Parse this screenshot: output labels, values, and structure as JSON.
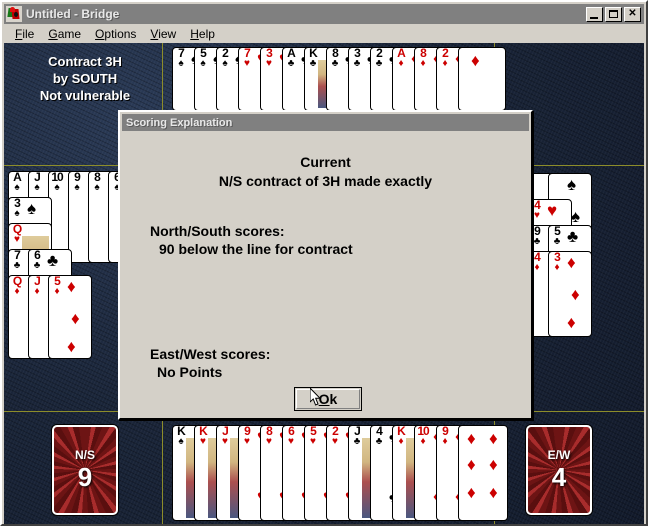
{
  "window": {
    "title": "Untitled - Bridge",
    "icon": "bridge-cards-icon",
    "buttons": {
      "minimize": "minimize-icon",
      "maximize": "maximize-icon",
      "close": "✕"
    }
  },
  "menu": {
    "items": [
      {
        "label": "File",
        "accel": "F"
      },
      {
        "label": "Game",
        "accel": "G"
      },
      {
        "label": "Options",
        "accel": "O"
      },
      {
        "label": "View",
        "accel": "V"
      },
      {
        "label": "Help",
        "accel": "H"
      }
    ]
  },
  "table": {
    "contract": {
      "line1": "Contract 3H",
      "line2": "by SOUTH",
      "line3": "Not vulnerable"
    },
    "scores": {
      "ns": {
        "label": "N/S",
        "value": "9"
      },
      "ew": {
        "label": "E/W",
        "value": "4"
      }
    },
    "hands": {
      "north": [
        {
          "rank": "7",
          "suit": "S"
        },
        {
          "rank": "5",
          "suit": "S"
        },
        {
          "rank": "2",
          "suit": "S"
        },
        {
          "rank": "7",
          "suit": "H"
        },
        {
          "rank": "3",
          "suit": "H"
        },
        {
          "rank": "A",
          "suit": "C"
        },
        {
          "rank": "K",
          "suit": "C"
        },
        {
          "rank": "8",
          "suit": "C"
        },
        {
          "rank": "3",
          "suit": "C"
        },
        {
          "rank": "2",
          "suit": "C"
        },
        {
          "rank": "A",
          "suit": "D"
        },
        {
          "rank": "8",
          "suit": "D"
        },
        {
          "rank": "2",
          "suit": "D"
        }
      ],
      "west": [
        {
          "rank": "A",
          "suit": "S"
        },
        {
          "rank": "J",
          "suit": "S"
        },
        {
          "rank": "10",
          "suit": "S"
        },
        {
          "rank": "9",
          "suit": "S"
        },
        {
          "rank": "8",
          "suit": "S"
        },
        {
          "rank": "6",
          "suit": "S"
        },
        {
          "rank": "3",
          "suit": "S"
        },
        {
          "rank": "Q",
          "suit": "H"
        },
        {
          "rank": "7",
          "suit": "C"
        },
        {
          "rank": "6",
          "suit": "C"
        },
        {
          "rank": "Q",
          "suit": "D"
        },
        {
          "rank": "J",
          "suit": "D"
        },
        {
          "rank": "5",
          "suit": "D"
        }
      ],
      "east": [
        {
          "rank": "",
          "suit": "S"
        },
        {
          "rank": "",
          "suit": "S"
        },
        {
          "rank": "4",
          "suit": "H"
        },
        {
          "rank": "9",
          "suit": "C"
        },
        {
          "rank": "5",
          "suit": "C"
        },
        {
          "rank": "4",
          "suit": "D"
        },
        {
          "rank": "3",
          "suit": "D"
        }
      ],
      "south": [
        {
          "rank": "K",
          "suit": "S"
        },
        {
          "rank": "K",
          "suit": "H"
        },
        {
          "rank": "J",
          "suit": "H"
        },
        {
          "rank": "9",
          "suit": "H"
        },
        {
          "rank": "8",
          "suit": "H"
        },
        {
          "rank": "6",
          "suit": "H"
        },
        {
          "rank": "5",
          "suit": "H"
        },
        {
          "rank": "2",
          "suit": "H"
        },
        {
          "rank": "J",
          "suit": "C"
        },
        {
          "rank": "4",
          "suit": "C"
        },
        {
          "rank": "K",
          "suit": "D"
        },
        {
          "rank": "10",
          "suit": "D"
        },
        {
          "rank": "9",
          "suit": "D"
        }
      ]
    }
  },
  "dialog": {
    "title": "Scoring Explanation",
    "heading": "Current",
    "subheading": "N/S contract of 3H made exactly",
    "ns_label": "North/South scores:",
    "ns_value": "90 below the line for contract",
    "ew_label": "East/West scores:",
    "ew_value": "No Points",
    "ok_accel": "O",
    "ok_rest": "k",
    "ok_label": "Ok"
  },
  "colors": {
    "felt": "#1a2539",
    "divider": "#8d8d2a",
    "face": "#d4d0c8",
    "titlebar": "#808080",
    "red_suit": "#cc0000",
    "black_suit": "#000000",
    "card_back": "#8d2020"
  }
}
